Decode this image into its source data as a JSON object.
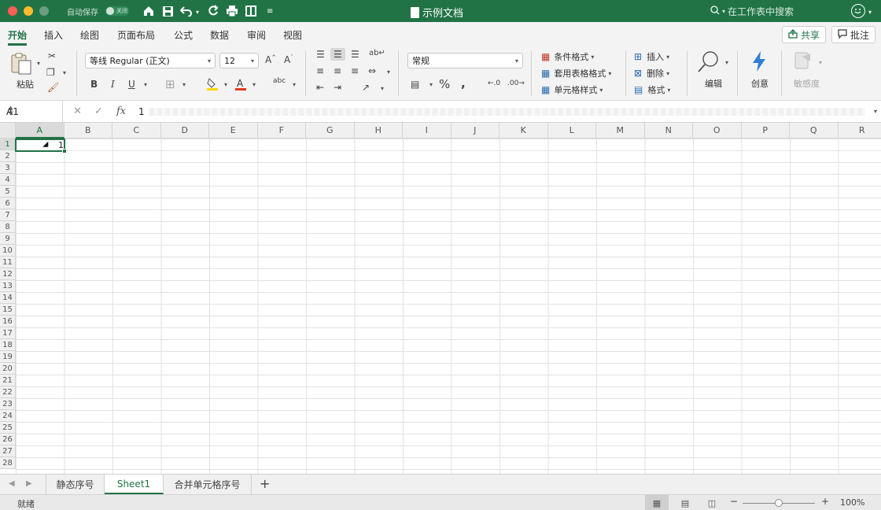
{
  "window": {
    "title": "示例文档",
    "autosave_label": "自动保存",
    "autosave_state": "关闭",
    "search_placeholder": "在工作表中搜索"
  },
  "ribbon_tabs": [
    "开始",
    "插入",
    "绘图",
    "页面布局",
    "公式",
    "数据",
    "审阅",
    "视图"
  ],
  "ribbon_actions": {
    "share": "共享",
    "comment": "批注"
  },
  "ribbon": {
    "paste": "粘贴",
    "font_name": "等线 Regular (正文)",
    "font_size": "12",
    "number_format": "常规",
    "cond_format": "条件格式",
    "table_format": "套用表格格式",
    "cell_style": "单元格样式",
    "insert": "插入",
    "delete": "删除",
    "format": "格式",
    "edit": "编辑",
    "ideas": "创意",
    "sensitivity": "敏感度"
  },
  "formula_bar": {
    "name_box": "A1",
    "fx": "fx",
    "value": "1"
  },
  "columns": [
    "A",
    "B",
    "C",
    "D",
    "E",
    "F",
    "G",
    "H",
    "I",
    "J",
    "K",
    "L",
    "M",
    "N",
    "O",
    "P",
    "Q",
    "R"
  ],
  "rows": [
    "1",
    "2",
    "3",
    "4",
    "5",
    "6",
    "7",
    "8",
    "9",
    "10",
    "11",
    "12",
    "13",
    "14",
    "15",
    "16",
    "17",
    "18",
    "19",
    "20",
    "21",
    "22",
    "23",
    "24",
    "25",
    "26",
    "27",
    "28"
  ],
  "cells": {
    "A1": "1"
  },
  "sheets": [
    "静态序号",
    "Sheet1",
    "合并单元格序号"
  ],
  "active_sheet": "Sheet1",
  "status": {
    "text": "就绪",
    "zoom": "100%"
  },
  "colors": {
    "accent": "#217346"
  }
}
